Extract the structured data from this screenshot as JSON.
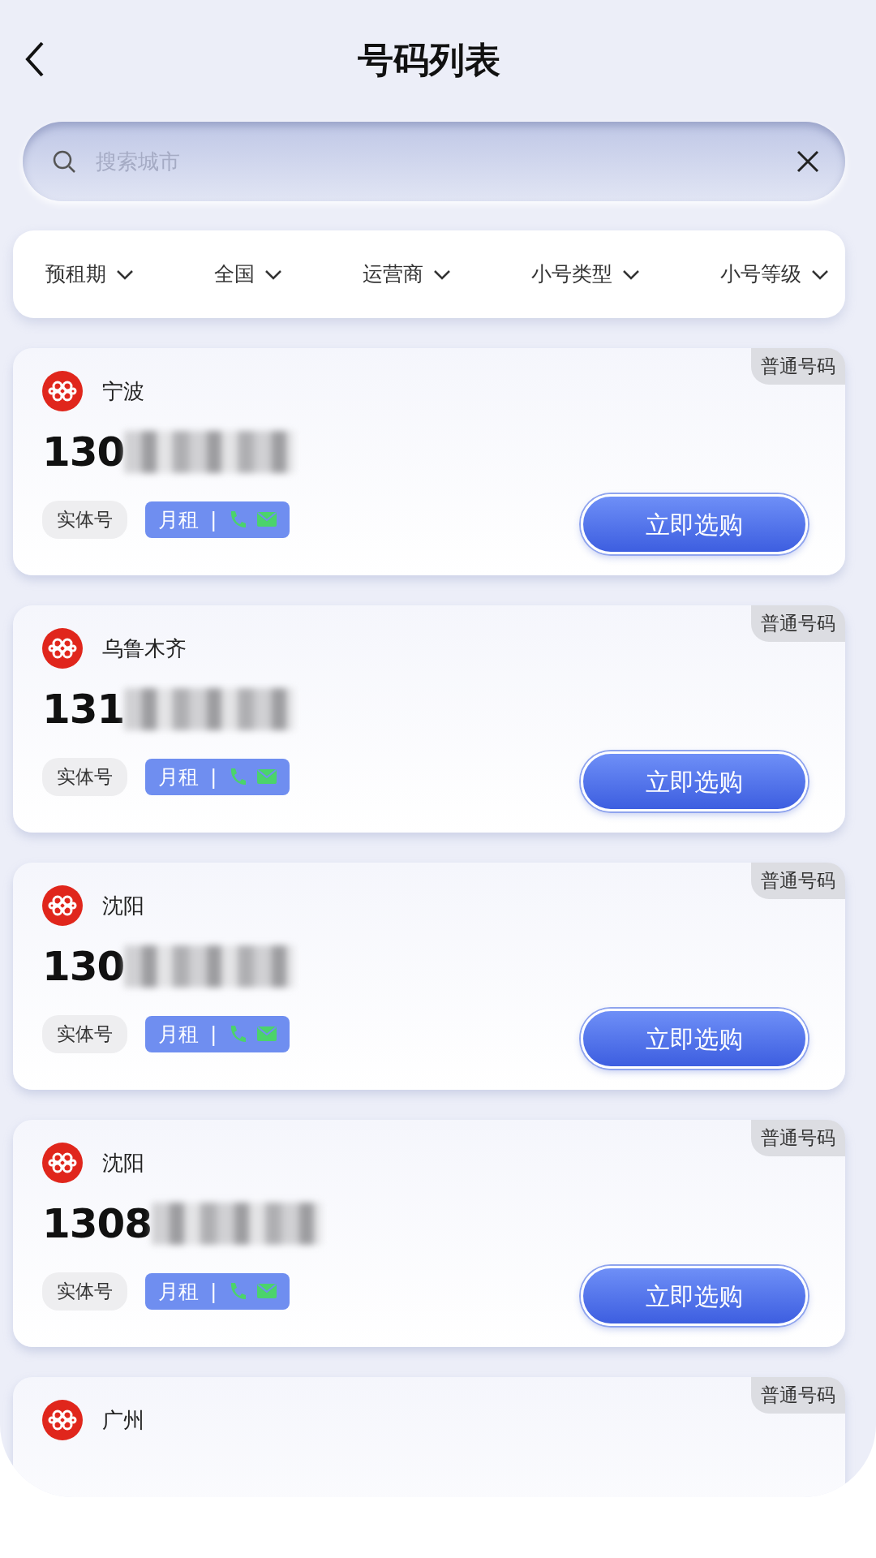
{
  "header": {
    "title": "号码列表"
  },
  "search": {
    "placeholder": "搜索城市"
  },
  "filters": [
    {
      "label": "预租期"
    },
    {
      "label": "全国"
    },
    {
      "label": "运营商"
    },
    {
      "label": "小号类型"
    },
    {
      "label": "小号等级"
    }
  ],
  "numbers": [
    {
      "badge": "普通号码",
      "city": "宁波",
      "number_prefix": "130",
      "type_tag": "实体号",
      "plan_tag": "月租",
      "separator": "|",
      "button": "立即选购"
    },
    {
      "badge": "普通号码",
      "city": "乌鲁木齐",
      "number_prefix": "131",
      "type_tag": "实体号",
      "plan_tag": "月租",
      "separator": "|",
      "button": "立即选购"
    },
    {
      "badge": "普通号码",
      "city": "沈阳",
      "number_prefix": "130",
      "type_tag": "实体号",
      "plan_tag": "月租",
      "separator": "|",
      "button": "立即选购"
    },
    {
      "badge": "普通号码",
      "city": "沈阳",
      "number_prefix": "1308",
      "type_tag": "实体号",
      "plan_tag": "月租",
      "separator": "|",
      "button": "立即选购"
    },
    {
      "badge": "普通号码",
      "city": "广州"
    }
  ]
}
